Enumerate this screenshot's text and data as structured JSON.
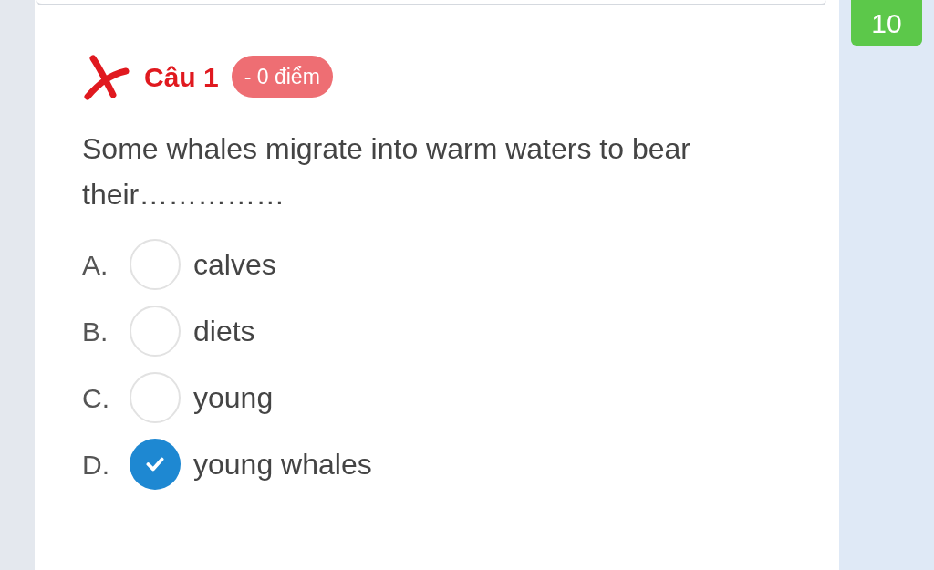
{
  "counter": "10",
  "question": {
    "title": "Câu 1",
    "correct": false,
    "score": "- 0 điểm",
    "text": "Some whales migrate into warm waters to bear their……………",
    "options": [
      {
        "letter": "A.",
        "text": "calves",
        "selected": false
      },
      {
        "letter": "B.",
        "text": "diets",
        "selected": false
      },
      {
        "letter": "C.",
        "text": "young",
        "selected": false
      },
      {
        "letter": "D.",
        "text": "young whales",
        "selected": true
      }
    ]
  }
}
